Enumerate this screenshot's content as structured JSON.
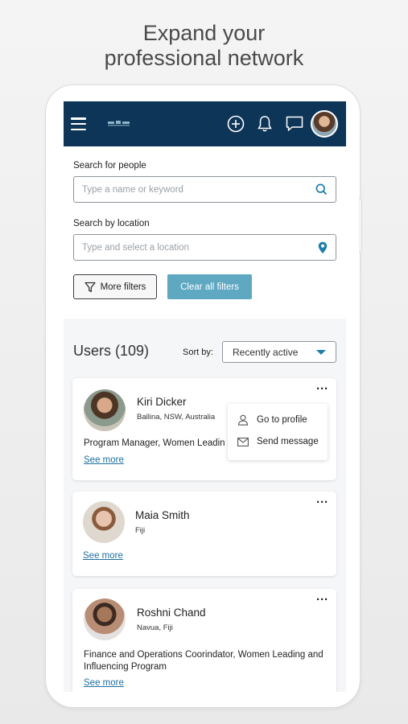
{
  "headline": {
    "line1": "Expand your",
    "line2": "professional network"
  },
  "search": {
    "people_label": "Search for people",
    "people_placeholder": "Type a name or keyword",
    "location_label": "Search by location",
    "location_placeholder": "Type and select a location",
    "more_filters": "More filters",
    "clear_filters": "Clear all filters"
  },
  "results": {
    "count_label": "Users (109)",
    "sort_label": "Sort by:",
    "sort_value": "Recently active"
  },
  "menu": {
    "go_to_profile": "Go to profile",
    "send_message": "Send message"
  },
  "users": [
    {
      "name": "Kiri Dicker",
      "location": "Ballina, NSW, Australia",
      "role": "Program Manager, Women Leadin",
      "see_more": "See more"
    },
    {
      "name": "Maia Smith",
      "location": "Fiji",
      "see_more": "See more"
    },
    {
      "name": "Roshni Chand",
      "location": "Navua, Fiji",
      "role": "Finance and Operations Coorindator, Women Leading and Influencing Program",
      "see_more": "See more"
    }
  ],
  "colors": {
    "topbar": "#0d3557",
    "accent": "#5ea8c2",
    "link": "#1b6fa3"
  },
  "icons": [
    "menu-icon",
    "plus-circle-icon",
    "bell-icon",
    "chat-icon",
    "search-icon",
    "location-pin-icon",
    "filter-icon",
    "more-options-icon",
    "person-icon",
    "envelope-icon"
  ]
}
